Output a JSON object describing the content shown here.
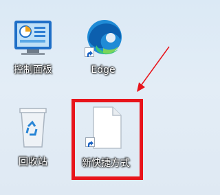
{
  "desktop": {
    "icons": [
      {
        "label": "控制面板",
        "icon": "control-panel-icon"
      },
      {
        "label": "Edge",
        "icon": "edge-browser-icon"
      },
      {
        "label": "回收站",
        "icon": "recycle-bin-icon"
      },
      {
        "label": "新快捷方式",
        "icon": "blank-document-shortcut-icon"
      }
    ]
  },
  "annotation": {
    "highlight_color": "#e8141b",
    "arrow_color": "#e8141b"
  }
}
